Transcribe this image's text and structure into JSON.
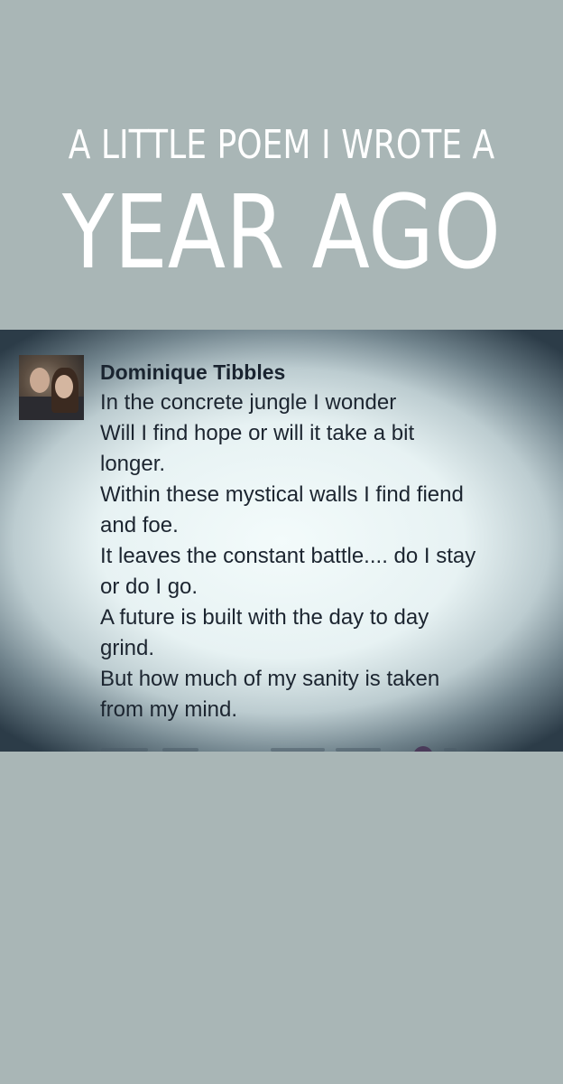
{
  "header": {
    "line1": "A LITTLE POEM I WROTE A",
    "line2": "YEAR AGO"
  },
  "post": {
    "author": "Dominique Tibbles",
    "avatar_icon": "profile-photo",
    "lines": [
      "In the concrete jungle I wonder",
      "Will I find hope or will it take a bit",
      "longer.",
      "Within these mystical walls I find fiend",
      "and foe.",
      "It leaves the constant battle.... do I stay",
      "or do I go.",
      "A future is built with the day to day",
      "grind.",
      "But how much of my sanity is taken",
      "from my mind."
    ]
  },
  "colors": {
    "background": "#a9b6b6",
    "title_text": "#ffffff",
    "post_text": "#1c2530"
  }
}
